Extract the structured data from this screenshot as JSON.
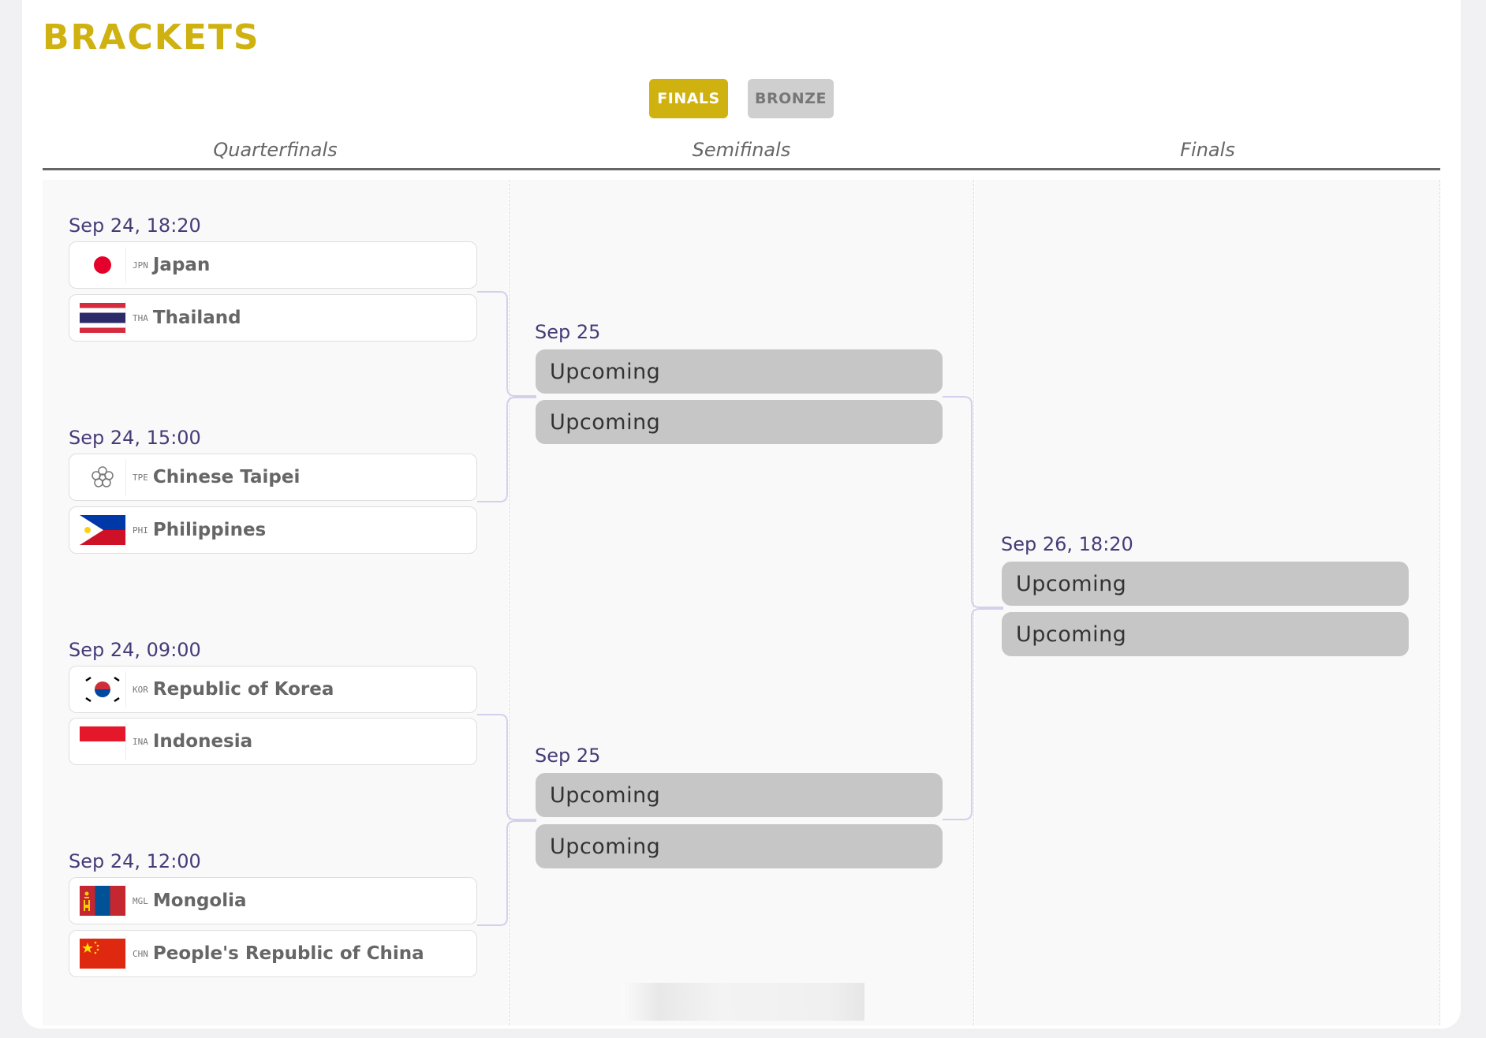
{
  "header": {
    "title": "BRACKETS"
  },
  "tabs": [
    {
      "label": "FINALS",
      "active": true
    },
    {
      "label": "BRONZE",
      "active": false
    }
  ],
  "rounds": [
    "Quarterfinals",
    "Semifinals",
    "Finals"
  ],
  "quarterfinals": [
    {
      "date": "Sep 24, 18:20",
      "teams": [
        {
          "code": "JPN",
          "name": "Japan",
          "flag": "flag-japan-icon"
        },
        {
          "code": "THA",
          "name": "Thailand",
          "flag": "flag-thailand-icon"
        }
      ]
    },
    {
      "date": "Sep 24, 15:00",
      "teams": [
        {
          "code": "TPE",
          "name": "Chinese Taipei",
          "flag": "flag-chinese-taipei-icon"
        },
        {
          "code": "PHI",
          "name": "Philippines",
          "flag": "flag-philippines-icon"
        }
      ]
    },
    {
      "date": "Sep 24, 09:00",
      "teams": [
        {
          "code": "KOR",
          "name": "Republic of Korea",
          "flag": "flag-korea-icon"
        },
        {
          "code": "INA",
          "name": "Indonesia",
          "flag": "flag-indonesia-icon"
        }
      ]
    },
    {
      "date": "Sep 24, 12:00",
      "teams": [
        {
          "code": "MGL",
          "name": "Mongolia",
          "flag": "flag-mongolia-icon"
        },
        {
          "code": "CHN",
          "name": "People's Republic of China",
          "flag": "flag-china-icon"
        }
      ]
    }
  ],
  "semifinals": [
    {
      "date": "Sep 25",
      "slots": [
        "Upcoming",
        "Upcoming"
      ]
    },
    {
      "date": "Sep 25",
      "slots": [
        "Upcoming",
        "Upcoming"
      ]
    }
  ],
  "finals": [
    {
      "date": "Sep 26, 18:20",
      "slots": [
        "Upcoming",
        "Upcoming"
      ]
    }
  ],
  "colors": {
    "accent": "#cfb20f",
    "date_text": "#473b78",
    "slot_bg": "#c6c6c6",
    "connector": "#d4d0ec"
  }
}
